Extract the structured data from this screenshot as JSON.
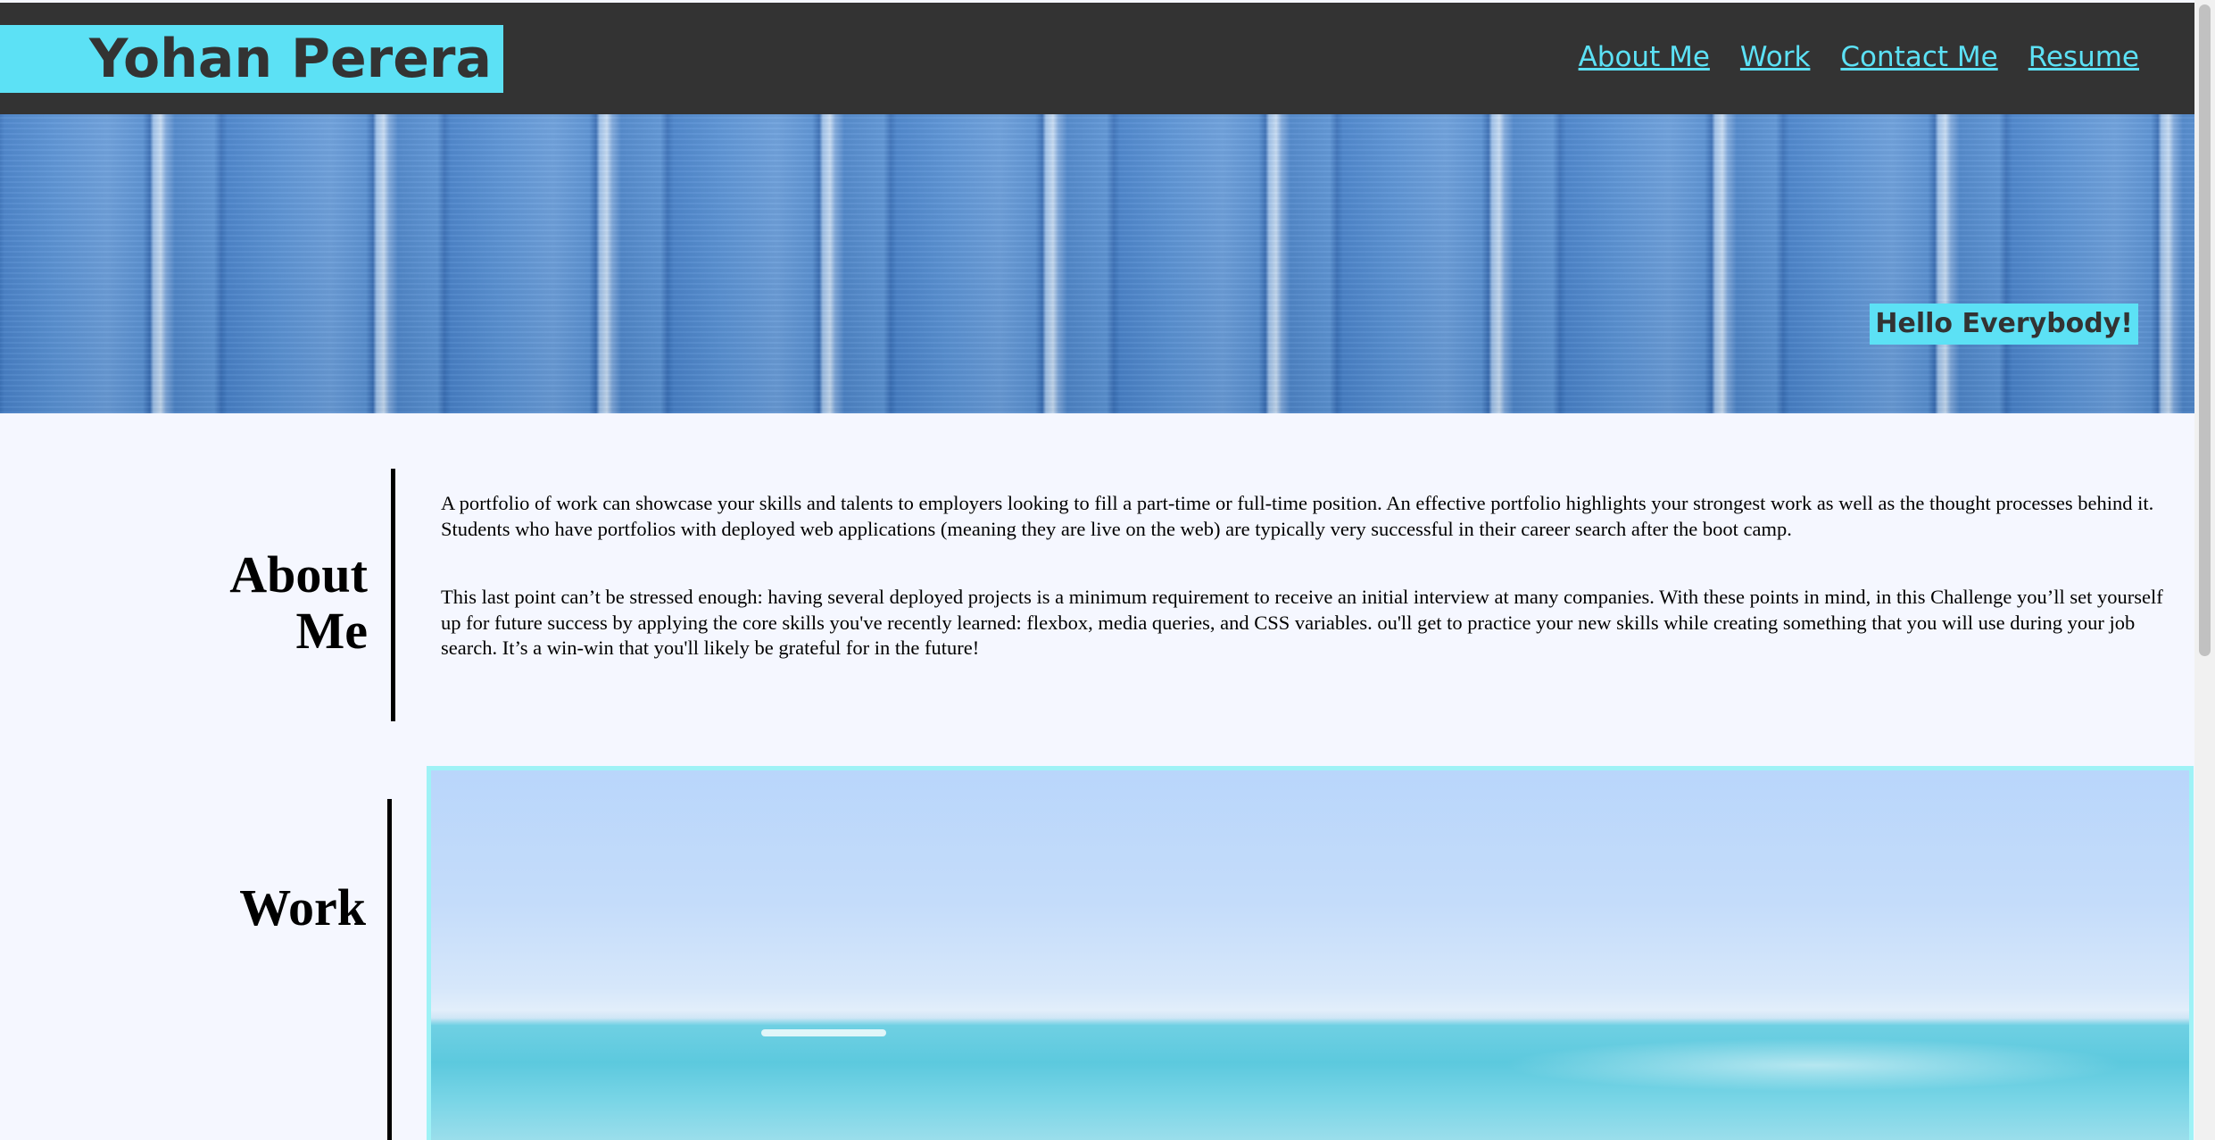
{
  "header": {
    "brand": "Yohan Perera",
    "nav": [
      "About Me",
      "Work",
      "Contact Me",
      "Resume"
    ]
  },
  "hero": {
    "greeting": "Hello Everybody!"
  },
  "about": {
    "title_line1": "About",
    "title_line2": "Me",
    "paragraphs": [
      "A portfolio of work can showcase your skills and talents to employers looking to fill a part-time or full-time position. An effective portfolio highlights your strongest work as well as the thought processes behind it. Students who have portfolios with deployed web applications (meaning they are live on the web) are typically very successful in their career search after the boot camp.",
      "This last point can’t be stressed enough: having several deployed projects is a minimum requirement to receive an initial interview at many companies. With these points in mind, in this Challenge you’ll set yourself up for future success by applying the core skills you've recently learned: flexbox, media queries, and CSS variables. ou'll get to practice your new skills while creating something that you will use during your job search. It’s a win-win that you'll likely be grateful for in the future!"
    ]
  },
  "work": {
    "title": "Work"
  },
  "colors": {
    "accent": "#5ce1f5",
    "header_bg": "#333333",
    "page_bg": "#f5f7ff",
    "card_border": "#9ff2f6"
  }
}
